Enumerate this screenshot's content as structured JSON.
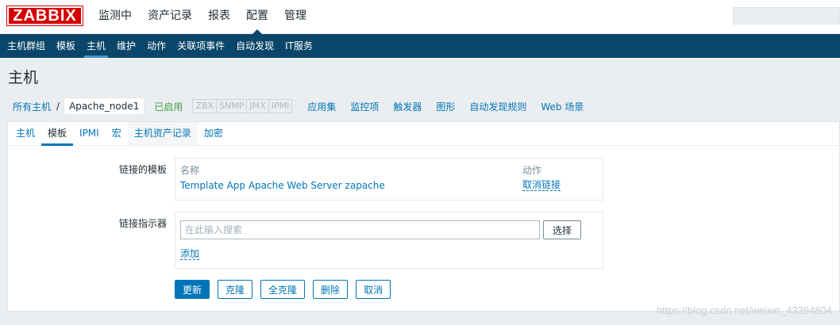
{
  "logo": "ZABBIX",
  "top_nav": [
    {
      "label": "监测中",
      "active": false
    },
    {
      "label": "资产记录",
      "active": false
    },
    {
      "label": "报表",
      "active": false
    },
    {
      "label": "配置",
      "active": true
    },
    {
      "label": "管理",
      "active": false
    }
  ],
  "sub_nav": [
    {
      "label": "主机群组",
      "active": false
    },
    {
      "label": "模板",
      "active": false
    },
    {
      "label": "主机",
      "active": true
    },
    {
      "label": "维护",
      "active": false
    },
    {
      "label": "动作",
      "active": false
    },
    {
      "label": "关联项事件",
      "active": false
    },
    {
      "label": "自动发现",
      "active": false
    },
    {
      "label": "IT服务",
      "active": false
    }
  ],
  "page_title": "主机",
  "host_nav": {
    "all_hosts": "所有主机",
    "separator": "/",
    "current_host": "Apache_node1",
    "status": "已启用",
    "availability": [
      "ZBX",
      "SNMP",
      "JMX",
      "IPMI"
    ],
    "links": [
      "应用集",
      "监控项",
      "触发器",
      "图形",
      "自动发现规则",
      "Web 场景"
    ]
  },
  "tabs": [
    {
      "label": "主机",
      "active": false
    },
    {
      "label": "模板",
      "active": true
    },
    {
      "label": "IPMI",
      "active": false
    },
    {
      "label": "宏",
      "active": false
    },
    {
      "label": "主机资产记录",
      "active": false
    },
    {
      "label": "加密",
      "active": false
    }
  ],
  "linked_templates": {
    "label": "链接的模板",
    "col_name": "名称",
    "col_action": "动作",
    "rows": [
      {
        "name": "Template App Apache Web Server zapache",
        "action": "取消链接"
      }
    ]
  },
  "link_indicator": {
    "label": "链接指示器",
    "placeholder": "在此输入搜索",
    "select_label": "选择",
    "add_label": "添加"
  },
  "buttons": {
    "update": "更新",
    "clone": "克隆",
    "full_clone": "全克隆",
    "delete": "删除",
    "cancel": "取消"
  },
  "watermark": "https://blog.csdn.net/weixin_43394804",
  "colors": {
    "brand_red": "#d40000",
    "subnav_bg": "#0a466a",
    "link_blue": "#0275b8",
    "enabled_green": "#429e47"
  }
}
